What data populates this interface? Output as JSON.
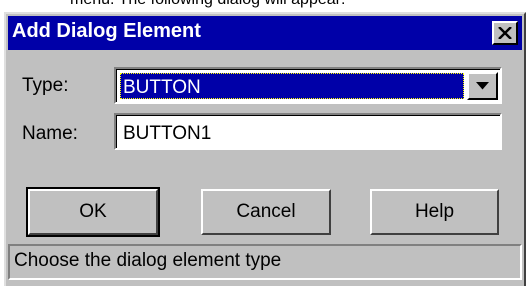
{
  "background_text": "menu. The following dialog will appear:",
  "dialog": {
    "title": "Add Dialog Element",
    "close_icon": "close-icon",
    "type_label": "Type:",
    "type_value": "BUTTON",
    "name_label": "Name:",
    "name_value": "BUTTON1",
    "buttons": {
      "ok": "OK",
      "cancel": "Cancel",
      "help": "Help"
    },
    "status": "Choose the dialog element type"
  },
  "colors": {
    "titlebar": "#0000a8",
    "face": "#c0c0c0",
    "selection": "#0000a8"
  }
}
